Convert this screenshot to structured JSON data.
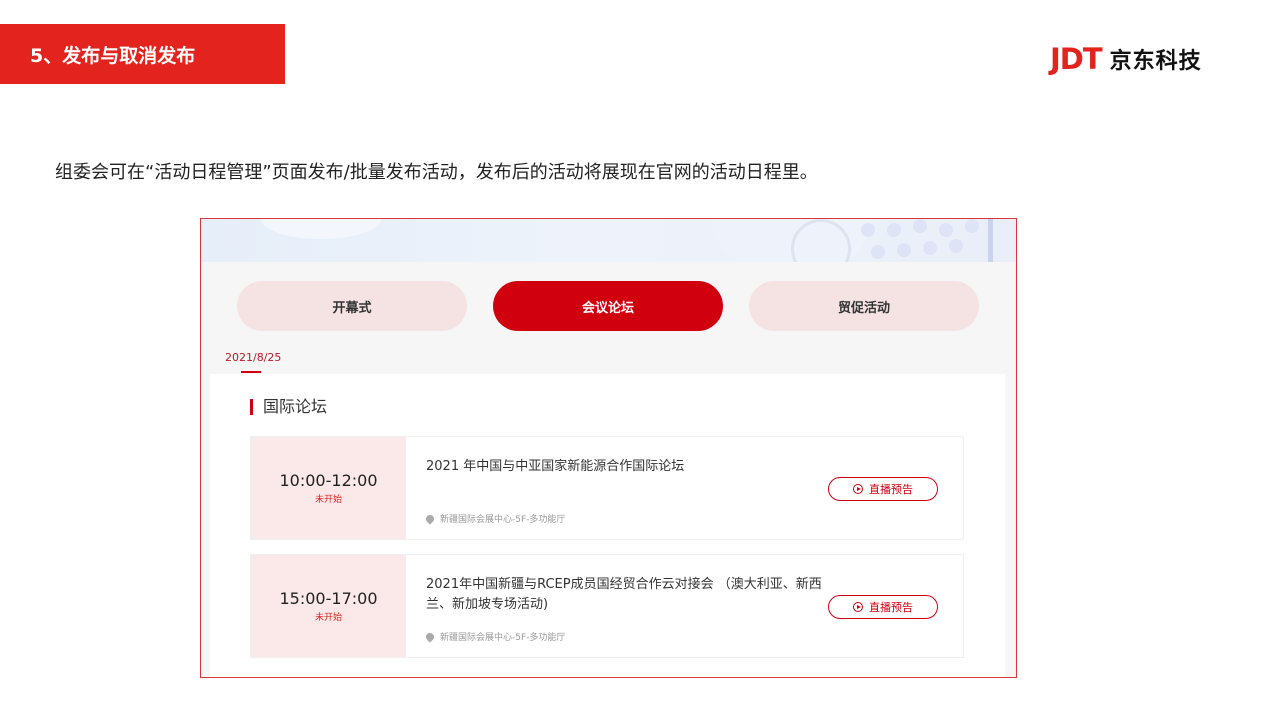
{
  "slide": {
    "section_label": "5、发布与取消发布",
    "logo_mark": "JDT",
    "logo_text": "京东科技",
    "intro": "组委会可在“活动日程管理”页面发布/批量发布活动，发布后的活动将展现在官网的活动日程里。"
  },
  "tabs": [
    {
      "label": "开幕式",
      "active": false
    },
    {
      "label": "会议论坛",
      "active": true
    },
    {
      "label": "贸促活动",
      "active": false
    }
  ],
  "date_tab": "2021/8/25",
  "panel": {
    "title": "国际论坛",
    "events": [
      {
        "time": "10:00-12:00",
        "status": "未开始",
        "title": "2021 年中国与中亚国家新能源合作国际论坛",
        "location": "新疆国际会展中心-5F-多功能厅",
        "action": "直播预告"
      },
      {
        "time": "15:00-17:00",
        "status": "未开始",
        "title": "2021年中国新疆与RCEP成员国经贸合作云对接会 （澳大利亚、新西兰、新加坡专场活动)",
        "location": "新疆国际会展中心-5F-多功能厅",
        "action": "直播预告"
      }
    ]
  },
  "colors": {
    "brand_red": "#e3231e",
    "active_tab": "#d0000f",
    "inactive_tab": "#f5e3e3",
    "time_box": "#fbe9e9"
  }
}
